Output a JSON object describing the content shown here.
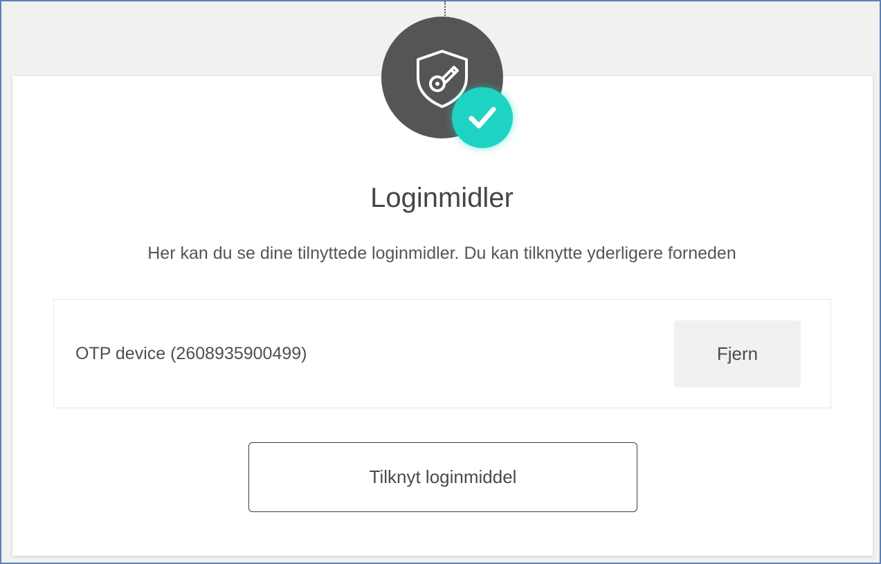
{
  "page": {
    "title": "Loginmidler",
    "subtitle": "Her kan du se dine tilnyttede loginmidler. Du kan tilknytte yderligere forneden"
  },
  "icons": {
    "badge": "shield-key-icon",
    "status": "checkmark-icon"
  },
  "devices": [
    {
      "label": "OTP device (2608935900499)",
      "remove_label": "Fjern"
    }
  ],
  "actions": {
    "add_label": "Tilknyt loginmiddel"
  },
  "colors": {
    "badge_bg": "#555555",
    "check_accent": "#1fd3c2",
    "page_bg": "#f1f1f0",
    "frame_border": "#5b7fb8"
  }
}
